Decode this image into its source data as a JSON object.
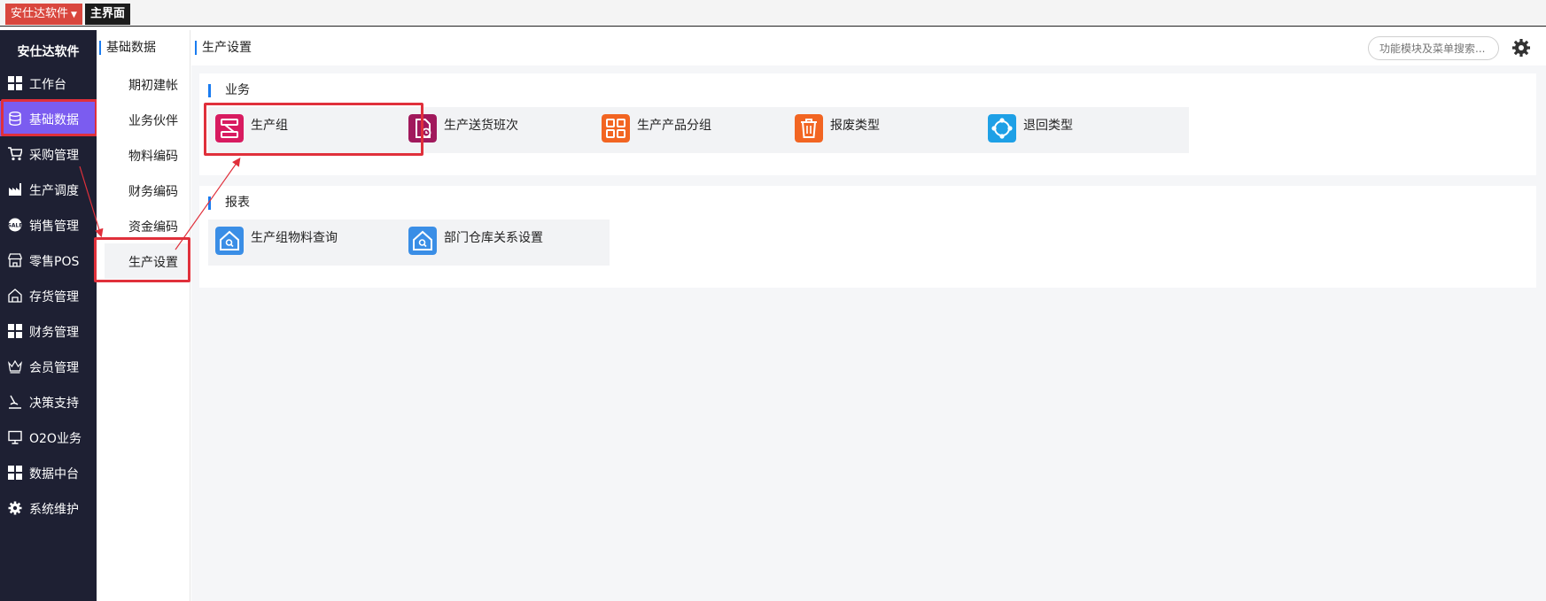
{
  "topbar": {
    "app_tab_label": "安仕达软件",
    "main_tab_label": "主界面"
  },
  "sidebar": {
    "title": "安仕达软件",
    "items": [
      {
        "label": "工作台",
        "icon": "grid-icon"
      },
      {
        "label": "基础数据",
        "icon": "database-icon",
        "active": true
      },
      {
        "label": "采购管理",
        "icon": "cart-icon"
      },
      {
        "label": "生产调度",
        "icon": "factory-icon"
      },
      {
        "label": "销售管理",
        "icon": "sale-badge-icon"
      },
      {
        "label": "零售POS",
        "icon": "store-icon"
      },
      {
        "label": "存货管理",
        "icon": "warehouse-icon"
      },
      {
        "label": "财务管理",
        "icon": "grid-icon"
      },
      {
        "label": "会员管理",
        "icon": "crown-icon"
      },
      {
        "label": "决策支持",
        "icon": "pen-icon"
      },
      {
        "label": "O2O业务",
        "icon": "monitor-icon"
      },
      {
        "label": "数据中台",
        "icon": "grid-icon"
      },
      {
        "label": "系统维护",
        "icon": "gear-icon"
      }
    ]
  },
  "subnav": {
    "header": "基础数据",
    "items": [
      {
        "label": "期初建帐"
      },
      {
        "label": "业务伙伴"
      },
      {
        "label": "物料编码"
      },
      {
        "label": "财务编码"
      },
      {
        "label": "资金编码"
      },
      {
        "label": "生产设置",
        "active": true
      }
    ]
  },
  "content": {
    "title": "生产设置",
    "search_placeholder": "功能模块及菜单搜索...",
    "sections": [
      {
        "title": "业务",
        "tiles": [
          {
            "label": "生产组",
            "icon": "production-group-icon",
            "color": "#d81b60"
          },
          {
            "label": "生产送货班次",
            "icon": "delivery-shift-icon",
            "color": "#a1195c"
          },
          {
            "label": "生产产品分组",
            "icon": "product-group-icon",
            "color": "#f26522"
          },
          {
            "label": "报废类型",
            "icon": "trash-icon",
            "color": "#f26522"
          },
          {
            "label": "退回类型",
            "icon": "return-type-icon",
            "color": "#1ea0e6"
          }
        ]
      },
      {
        "title": "报表",
        "tiles": [
          {
            "label": "生产组物料查询",
            "icon": "house-search-icon",
            "color": "#3a8ee6"
          },
          {
            "label": "部门仓库关系设置",
            "icon": "house-search-icon",
            "color": "#3a8ee6"
          }
        ]
      }
    ]
  },
  "colors": {
    "sidebar_bg": "#1e2033",
    "active_purple": "#7b5cf0",
    "highlight_red": "#e0303b",
    "accent_blue": "#1a7cf0"
  }
}
